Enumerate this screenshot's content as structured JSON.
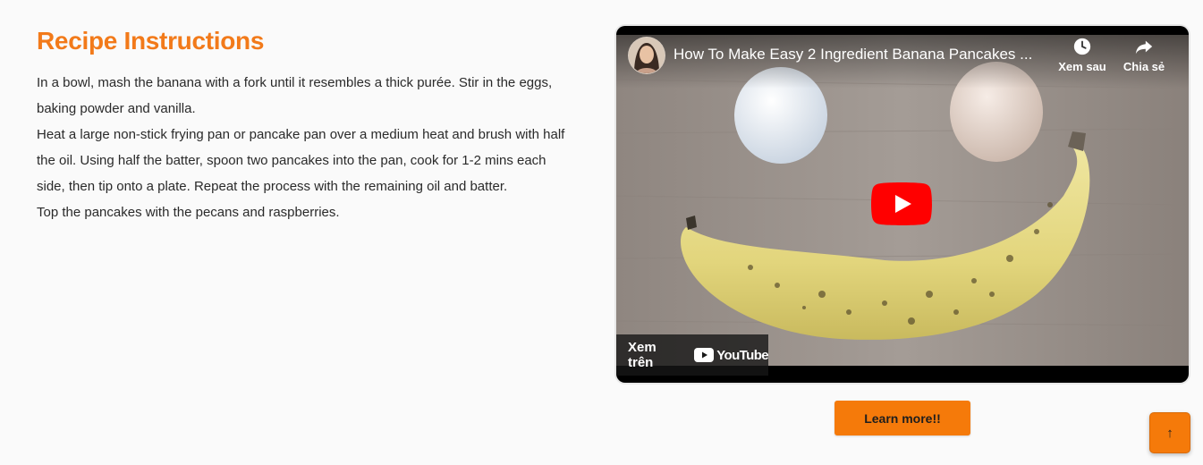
{
  "recipe": {
    "title": "Recipe Instructions",
    "steps": [
      "In a bowl, mash the banana with a fork until it resembles a thick purée. Stir in the eggs, baking powder and vanilla.",
      "Heat a large non-stick frying pan or pancake pan over a medium heat and brush with half the oil. Using half the batter, spoon two pancakes into the pan, cook for 1-2 mins each side, then tip onto a plate. Repeat the process with the remaining oil and batter.",
      "Top the pancakes with the pecans and raspberries."
    ]
  },
  "video": {
    "title": "How To Make Easy 2 Ingredient Banana Pancakes ...",
    "watch_later_label": "Xem sau",
    "share_label": "Chia sẻ",
    "watch_on_label": "Xem trên",
    "youtube_label": "YouTube",
    "icons": {
      "avatar": "channel-avatar",
      "watch_later": "clock-icon",
      "share": "share-arrow-icon",
      "play": "play-button-icon",
      "youtube_logo": "youtube-logo-icon"
    }
  },
  "actions": {
    "learn_more_label": "Learn more!!",
    "scroll_top_icon": "↑"
  },
  "colors": {
    "accent": "#f27a1a",
    "button": "#f57a0a",
    "youtube_red": "#ff0000"
  }
}
